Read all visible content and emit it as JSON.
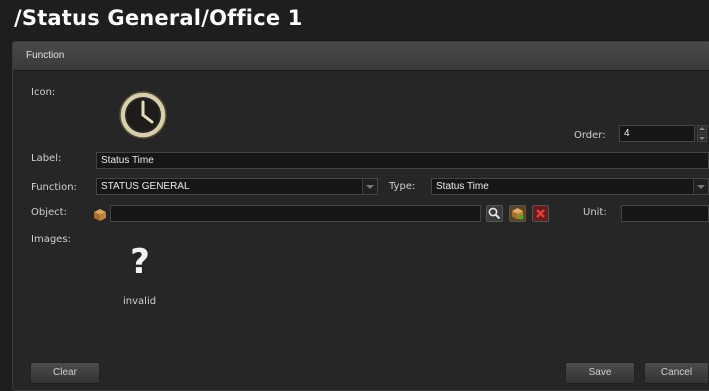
{
  "page": {
    "title": "/Status General/Office 1"
  },
  "panel": {
    "header": "Function"
  },
  "form": {
    "icon_label": "Icon:",
    "order_label": "Order:",
    "order_value": "4",
    "label_label": "Label:",
    "label_value": "Status Time",
    "function_label": "Function:",
    "function_value": "STATUS GENERAL",
    "type_label": "Type:",
    "type_value": "Status Time",
    "object_label": "Object:",
    "object_value": "",
    "unit_label": "Unit:",
    "unit_value": "",
    "images_label": "Images:",
    "image_placeholder": "?",
    "image_caption": "invalid"
  },
  "buttons": {
    "clear": "Clear",
    "save": "Save",
    "cancel": "Cancel"
  },
  "icons": {
    "function_icon": "clock-icon",
    "object_type": "package-icon",
    "search": "magnifier-icon",
    "select_object": "package-add-icon",
    "remove_object": "remove-icon",
    "image_placeholder": "question-mark-icon"
  },
  "colors": {
    "accent_box": "#b07a3a",
    "remove": "#a02020"
  }
}
